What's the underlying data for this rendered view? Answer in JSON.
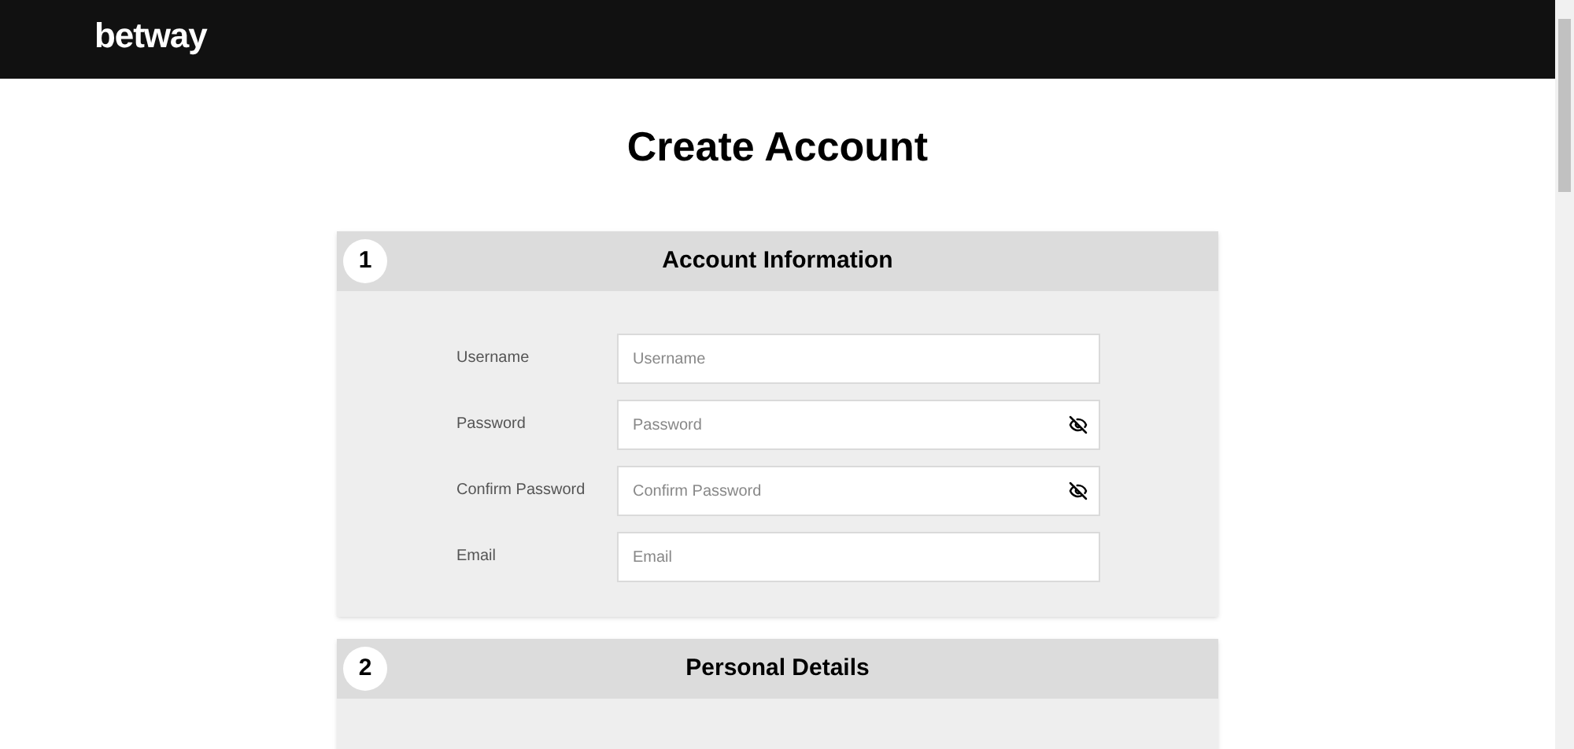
{
  "header": {
    "logo": "betway"
  },
  "title": "Create Account",
  "sections": [
    {
      "number": "1",
      "title": "Account Information",
      "fields": [
        {
          "label": "Username",
          "placeholder": "Username",
          "kind": "text"
        },
        {
          "label": "Password",
          "placeholder": "Password",
          "kind": "password"
        },
        {
          "label": "Confirm Password",
          "placeholder": "Confirm Password",
          "kind": "password"
        },
        {
          "label": "Email",
          "placeholder": "Email",
          "kind": "text"
        }
      ]
    },
    {
      "number": "2",
      "title": "Personal Details"
    }
  ]
}
